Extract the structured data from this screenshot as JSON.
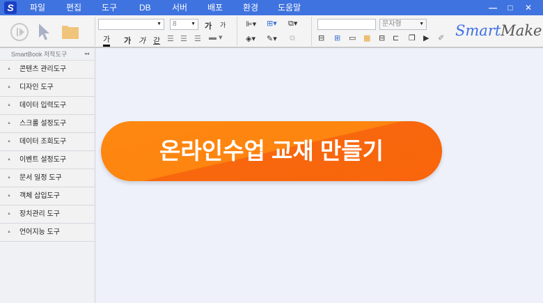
{
  "titlebar": {
    "logo": "S",
    "menu": [
      "파일",
      "편집",
      "도구",
      "DB",
      "서버",
      "배포",
      "환경",
      "도움말"
    ],
    "minimize": "—",
    "maximize": "□",
    "close": "✕"
  },
  "toolbar": {
    "font_size": "8",
    "grow_label": "가",
    "shrink_label": "가",
    "color_label": "가",
    "bold_label": "가",
    "italic_label": "가",
    "underline_label": "갇",
    "text_type": "문자형",
    "brand_smart": "Smart",
    "brand_maker": "Maker"
  },
  "sidebar": {
    "title": "SmartBook 저작도구",
    "collapse": "◂◂",
    "items": [
      "콘텐츠 관리도구",
      "디자인 도구",
      "데이터 입력도구",
      "스크롤 설정도구",
      "데이터 조회도구",
      "이벤트 설정도구",
      "문서 일정 도구",
      "객체 삽입도구",
      "장치관리 도구",
      "언어지능 도구"
    ]
  },
  "main": {
    "cta_label": "온라인수업 교재 만들기"
  },
  "colors": {
    "titlebar": "#3f73df",
    "cta": "#fd8510"
  }
}
